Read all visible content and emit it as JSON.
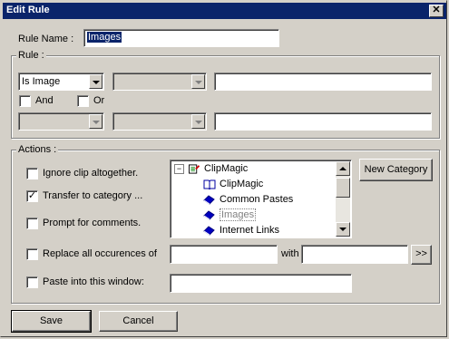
{
  "window": {
    "title": "Edit Rule",
    "close_glyph": "✕"
  },
  "rule_name": {
    "label": "Rule Name :",
    "value": "Images"
  },
  "rule_group": {
    "title": "Rule :",
    "condition1_value": "Is Image",
    "and_label": "And",
    "or_label": "Or"
  },
  "actions": {
    "title": "Actions :",
    "ignore_label": "Ignore clip altogether.",
    "transfer_label": "Transfer to category ...",
    "prompt_label": "Prompt for comments.",
    "replace_label": "Replace all occurences of",
    "with_label": "with",
    "paste_label": "Paste into this window:",
    "new_category_label": "New Category",
    "replace_browse_label": ">>",
    "transfer_checked": "✓"
  },
  "tree": {
    "expand_glyph": "−",
    "root": "ClipMagic",
    "items": [
      "ClipMagic",
      "Common Pastes",
      "Images",
      "Internet Links"
    ]
  },
  "buttons": {
    "save": "Save",
    "cancel": "Cancel"
  }
}
